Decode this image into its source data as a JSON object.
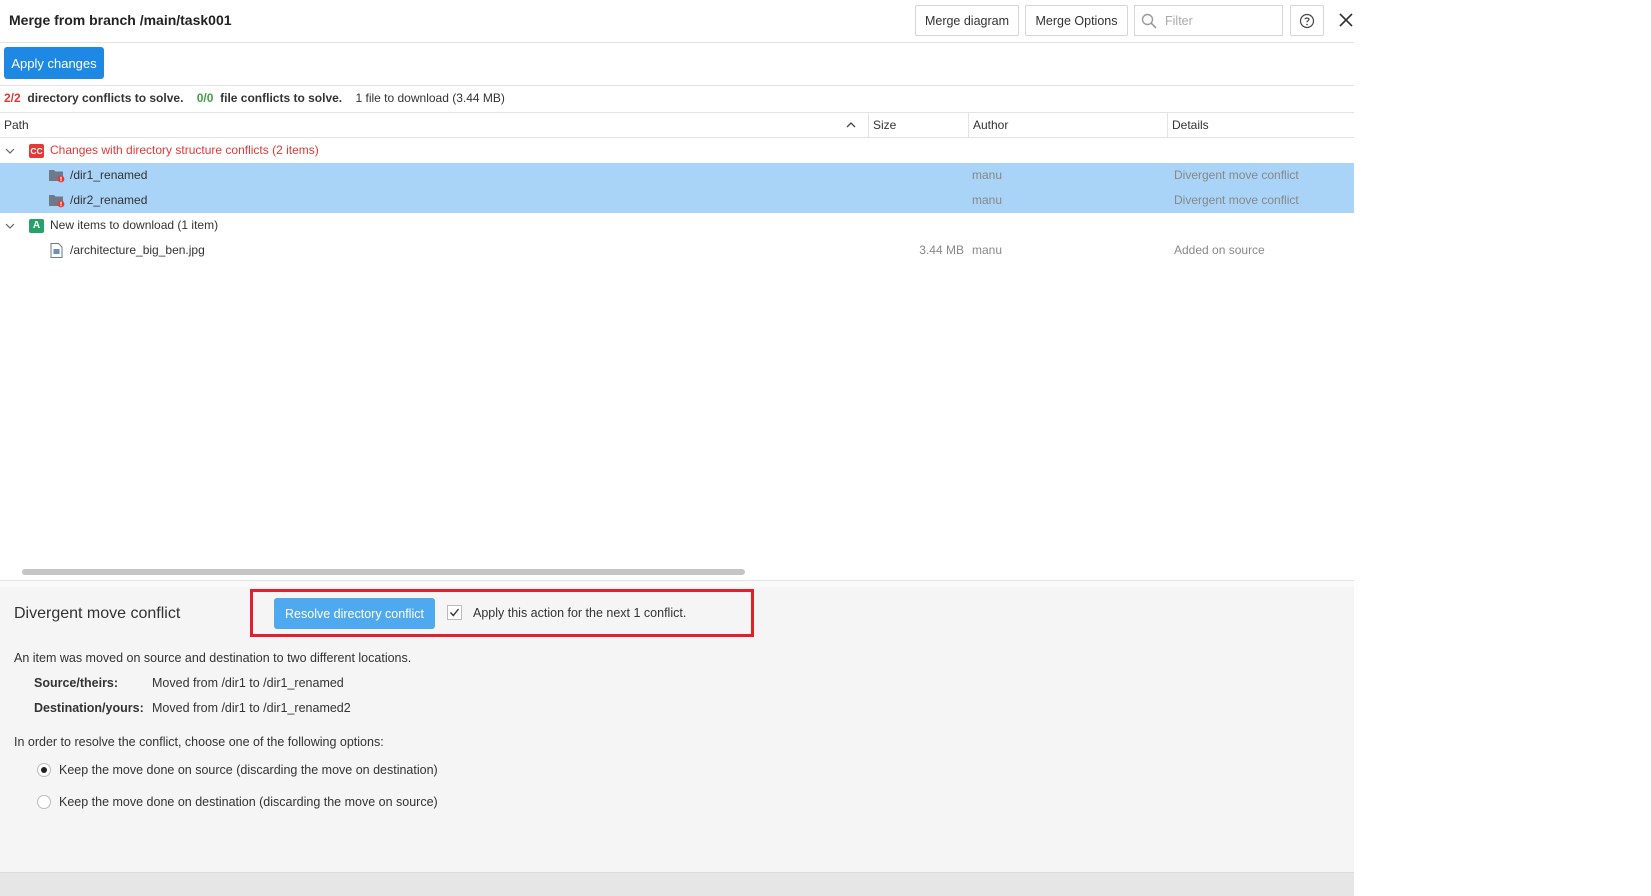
{
  "window": {
    "title": "Merge from branch /main/task001"
  },
  "header": {
    "merge_diagram": "Merge diagram",
    "merge_options": "Merge Options",
    "filter_placeholder": "Filter",
    "help_icon": "question-icon",
    "close_icon": "close-icon"
  },
  "toolbar": {
    "apply_changes": "Apply changes"
  },
  "status": {
    "dir_count": "2/2",
    "dir_text": "directory conflicts to solve.",
    "file_count": "0/0",
    "file_text": "file conflicts to solve.",
    "download_text": "1 file to download (3.44 MB)"
  },
  "table": {
    "columns": {
      "path": "Path",
      "size": "Size",
      "author": "Author",
      "details": "Details"
    },
    "groups": [
      {
        "badge": "CC",
        "label": "Changes with directory structure conflicts (2 items)",
        "items": [
          {
            "path": "/dir1_renamed",
            "size": "",
            "author": "manu",
            "details": "Divergent move conflict"
          },
          {
            "path": "/dir2_renamed",
            "size": "",
            "author": "manu",
            "details": "Divergent move conflict"
          }
        ]
      },
      {
        "badge": "A",
        "label": "New items to download (1 item)",
        "items": [
          {
            "path": "/architecture_big_ben.jpg",
            "size": "3.44 MB",
            "author": "manu",
            "details": "Added on source"
          }
        ]
      }
    ]
  },
  "panel": {
    "title": "Divergent move conflict",
    "resolve_button": "Resolve directory conflict",
    "apply_next": "Apply this action for the next 1 conflict.",
    "description": "An item was moved on source and destination to two different locations.",
    "source_label": "Source/theirs:",
    "source_value": "Moved from /dir1 to /dir1_renamed",
    "dest_label": "Destination/yours:",
    "dest_value": "Moved from /dir1 to /dir1_renamed2",
    "instructions": "In order to resolve the conflict, choose one of the following options:",
    "option_source": "Keep the move done on source (discarding the move on destination)",
    "option_destination": "Keep the move done on destination (discarding the move on source)",
    "selected_option": "source"
  },
  "colors": {
    "accent": "#1e88e5",
    "selection": "#a9d4f7",
    "conflict_red": "#e53935",
    "ok_green": "#43a047",
    "highlight_box": "#e0202b"
  }
}
